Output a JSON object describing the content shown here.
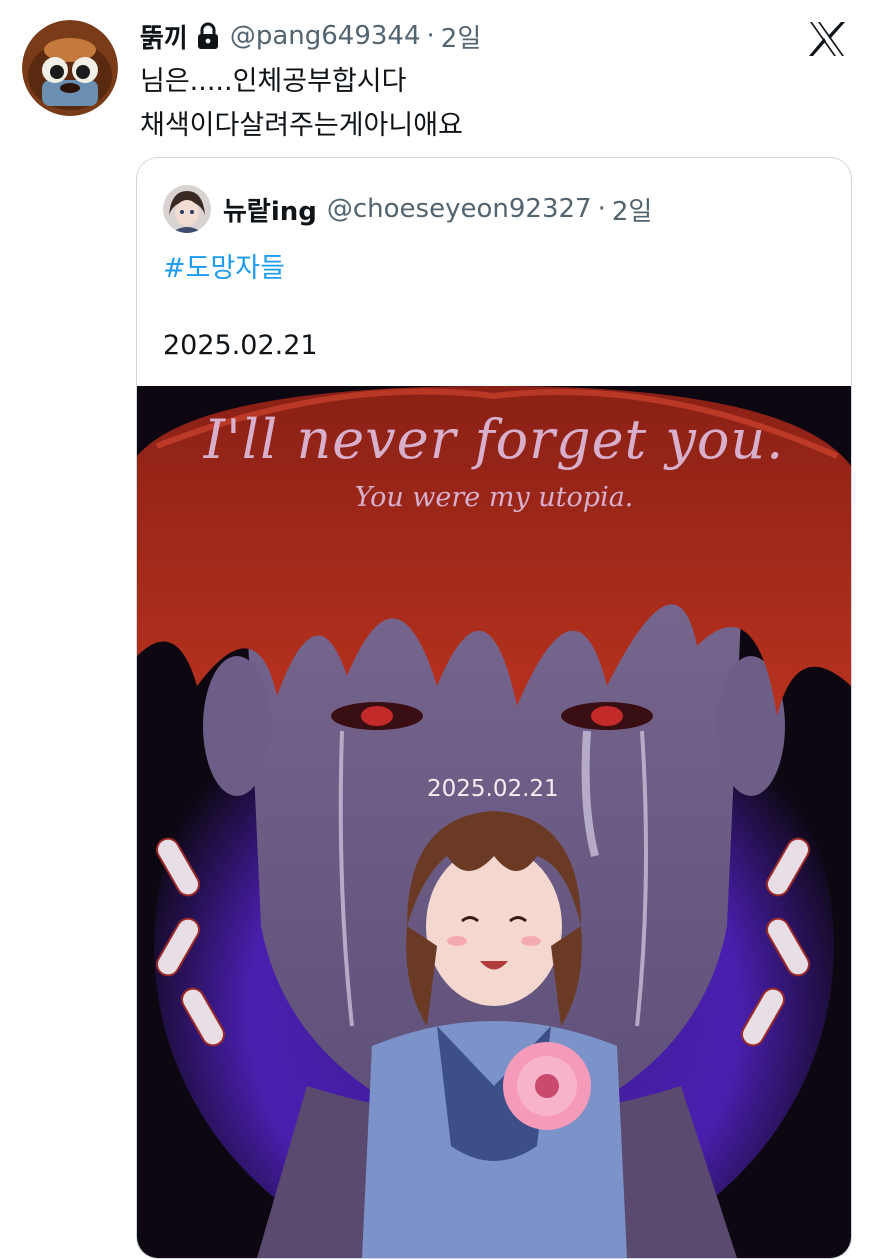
{
  "tweet": {
    "display_name": "뚥끼",
    "handle": "@pang649344",
    "separator": "·",
    "time": "2일",
    "lines": [
      "님은.....인체공부합시다",
      "채색이다살려주는게아니애요"
    ]
  },
  "quote": {
    "display_name": "뉴랕ing",
    "handle": "@choeseyeon92327",
    "separator": "·",
    "time": "2일",
    "hashtag": "#도망자들",
    "date_text": "2025.02.21"
  },
  "artwork": {
    "title": "I'll never forget you.",
    "subtitle": "You were my utopia.",
    "date": "2025.02.21"
  },
  "icons": {
    "lock": "lock-icon",
    "brand": "x-logo-icon"
  },
  "colors": {
    "link": "#1d9bf0",
    "secondary_text": "#536471",
    "primary_text": "#0f1419",
    "card_border": "#cfd9de"
  }
}
